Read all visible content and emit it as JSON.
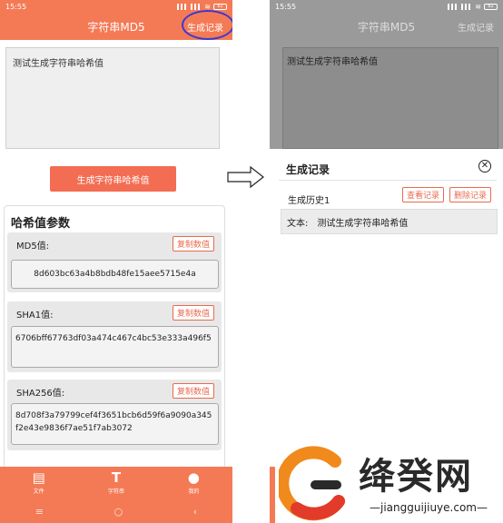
{
  "left": {
    "status": {
      "time": "15:55",
      "battery": "82"
    },
    "appbar": {
      "title": "字符串MD5",
      "action": "生成记录"
    },
    "input_text": "测试生成字符串哈希值",
    "generate_label": "生成字符串哈希值",
    "panel_title": "哈希值参数",
    "hashes": [
      {
        "label": "MD5值:",
        "copy": "复制数值",
        "value": "8d603bc63a4b8bdb48fe15aee5715e4a"
      },
      {
        "label": "SHA1值:",
        "copy": "复制数值",
        "value": "6706bff67763df03a474c467c4bc53e333a496f5"
      },
      {
        "label": "SHA256值:",
        "copy": "复制数值",
        "value": "8d708f3a79799cef4f3651bcb6d59f6a9090a345f2e43e9836f7ae51f7ab3072"
      }
    ],
    "nav": [
      {
        "label": "文件",
        "icon": "file-icon"
      },
      {
        "label": "字符串",
        "icon": "text-icon"
      },
      {
        "label": "我的",
        "icon": "user-icon"
      }
    ],
    "sysnav": [
      "≡",
      "○",
      "‹"
    ]
  },
  "right": {
    "status": {
      "time": "15:55",
      "battery": "82"
    },
    "appbar": {
      "title": "字符串MD5",
      "action": "生成记录"
    },
    "input_text": "测试生成字符串哈希值",
    "sheet": {
      "title": "生成记录",
      "history_label": "生成历史1",
      "view_label": "查看记录",
      "delete_label": "删除记录",
      "text_label": "文本:",
      "text_value": "测试生成字符串哈希值"
    }
  },
  "watermark": {
    "name": "绛癸网",
    "url": "—jiangguijiuye.com—"
  },
  "colors": {
    "accent": "#f47a56",
    "button": "#f36d52",
    "annotation": "#3a3ad0"
  }
}
